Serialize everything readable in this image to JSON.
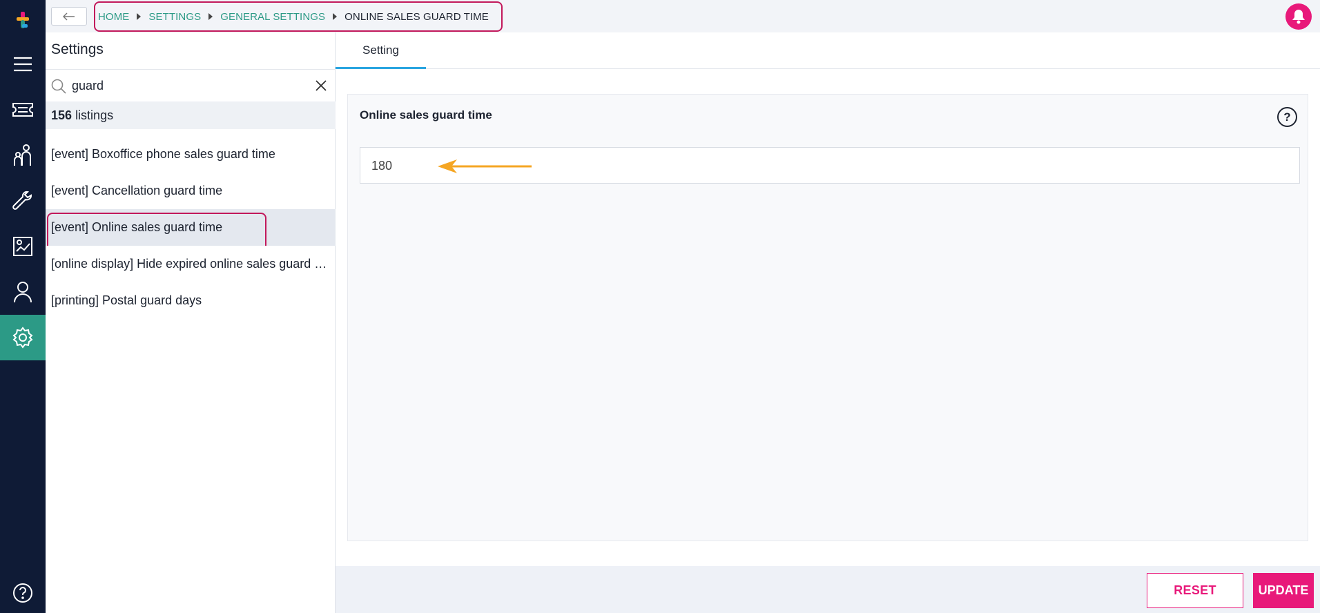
{
  "icons": {
    "logo": "app-logo-icon",
    "back": "arrow-left-icon",
    "bell": "bell-icon",
    "search": "search-icon",
    "clear": "close-icon",
    "help": "help-icon",
    "rail": [
      "menu-icon",
      "ticket-icon",
      "people-icon",
      "wrench-icon",
      "report-icon",
      "user-icon",
      "gear-icon",
      "help-circle-icon"
    ]
  },
  "colors": {
    "rail_bg": "#0f1b36",
    "rail_active": "#2c9a86",
    "accent": "#e8197a",
    "link": "#2c9a86",
    "highlight_annotation": "#c2185b",
    "arrow_annotation": "#f5a623",
    "tab_underline": "#2aa5e0"
  },
  "breadcrumb": {
    "items": [
      "HOME",
      "SETTINGS",
      "GENERAL SETTINGS",
      "ONLINE SALES GUARD TIME"
    ]
  },
  "sidebar": {
    "title": "Settings",
    "search": {
      "value": "guard"
    },
    "count": {
      "number": "156",
      "label": "listings"
    },
    "items": [
      {
        "label": "[event] Boxoffice phone sales guard time"
      },
      {
        "label": "[event] Cancellation guard time"
      },
      {
        "label": "[event] Online sales guard time",
        "selected": true
      },
      {
        "label": "[online display] Hide expired online sales guard time"
      },
      {
        "label": "[printing] Postal guard days"
      }
    ]
  },
  "main": {
    "tabs": [
      {
        "label": "Setting",
        "active": true
      }
    ],
    "field": {
      "label": "Online sales guard time",
      "help": "?",
      "value": "180"
    },
    "buttons": {
      "reset": "RESET",
      "update": "UPDATE"
    }
  }
}
